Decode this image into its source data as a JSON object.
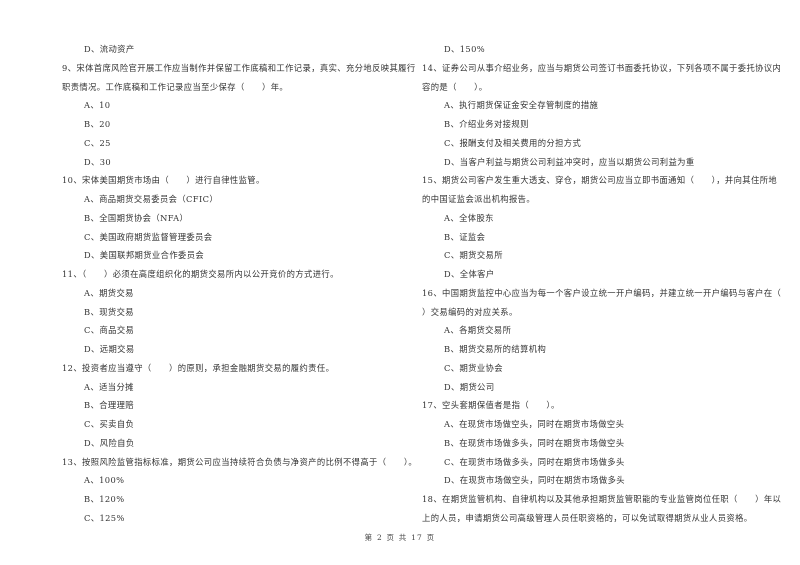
{
  "left_column": [
    {
      "type": "option",
      "text": "D、流动资产"
    },
    {
      "type": "question",
      "text": "9、宋体首席风险官开展工作应当制作并保留工作底稿和工作记录，真实、充分地反映其履行"
    },
    {
      "type": "question-cont",
      "text": "职责情况。工作底稿和工作记录应当至少保存（　　）年。"
    },
    {
      "type": "option",
      "text": "A、10"
    },
    {
      "type": "option",
      "text": "B、20"
    },
    {
      "type": "option",
      "text": "C、25"
    },
    {
      "type": "option",
      "text": "D、30"
    },
    {
      "type": "question",
      "text": "10、宋体美国期货市场由（　　）进行自律性监管。"
    },
    {
      "type": "option",
      "text": "A、商品期货交易委员会（CFIC）"
    },
    {
      "type": "option",
      "text": "B、全国期货协会（NFA）"
    },
    {
      "type": "option",
      "text": "C、美国政府期货监督管理委员会"
    },
    {
      "type": "option",
      "text": "D、美国联邦期货业合作委员会"
    },
    {
      "type": "question",
      "text": "11、（　　）必须在高度组织化的期货交易所内以公开竞价的方式进行。"
    },
    {
      "type": "option",
      "text": "A、期货交易"
    },
    {
      "type": "option",
      "text": "B、现货交易"
    },
    {
      "type": "option",
      "text": "C、商品交易"
    },
    {
      "type": "option",
      "text": "D、远期交易"
    },
    {
      "type": "question",
      "text": "12、投资者应当遵守（　　）的原则，承担金融期货交易的履约责任。"
    },
    {
      "type": "option",
      "text": "A、适当分摊"
    },
    {
      "type": "option",
      "text": "B、合理理赔"
    },
    {
      "type": "option",
      "text": "C、买卖自负"
    },
    {
      "type": "option",
      "text": "D、风险自负"
    },
    {
      "type": "question",
      "text": "13、按照风险监管指标标准，期货公司应当持续符合负债与净资产的比例不得高于（　　）。"
    },
    {
      "type": "option",
      "text": "A、100%"
    },
    {
      "type": "option",
      "text": "B、120%"
    },
    {
      "type": "option",
      "text": "C、125%"
    }
  ],
  "right_column": [
    {
      "type": "option",
      "text": "D、150%"
    },
    {
      "type": "question",
      "text": "14、证券公司从事介绍业务，应当与期货公司签订书面委托协议，下列各项不属于委托协议内"
    },
    {
      "type": "question-cont",
      "text": "容的是（　　）。"
    },
    {
      "type": "option",
      "text": "A、执行期货保证金安全存管制度的措施"
    },
    {
      "type": "option",
      "text": "B、介绍业务对接规则"
    },
    {
      "type": "option",
      "text": "C、报酬支付及相关费用的分担方式"
    },
    {
      "type": "option",
      "text": "D、当客户利益与期货公司利益冲突时，应当以期货公司利益为重"
    },
    {
      "type": "question",
      "text": "15、期货公司客户发生重大透支、穿仓，期货公司应当立即书面通知（　　），并向其住所地"
    },
    {
      "type": "question-cont",
      "text": "的中国证监会派出机构报告。"
    },
    {
      "type": "option",
      "text": "A、全体股东"
    },
    {
      "type": "option",
      "text": "B、证监会"
    },
    {
      "type": "option",
      "text": "C、期货交易所"
    },
    {
      "type": "option",
      "text": "D、全体客户"
    },
    {
      "type": "question",
      "text": "16、中国期货监控中心应当为每一个客户设立统一开户编码，并建立统一开户编码与客户在（"
    },
    {
      "type": "question-cont",
      "text": "）交易编码的对应关系。"
    },
    {
      "type": "option",
      "text": "A、各期货交易所"
    },
    {
      "type": "option",
      "text": "B、期货交易所的结算机构"
    },
    {
      "type": "option",
      "text": "C、期货业协会"
    },
    {
      "type": "option",
      "text": "D、期货公司"
    },
    {
      "type": "question",
      "text": "17、空头套期保值者是指（　　）。"
    },
    {
      "type": "option",
      "text": "A、在现货市场做空头，同时在期货市场做空头"
    },
    {
      "type": "option",
      "text": "B、在现货市场做多头，同时在期货市场做空头"
    },
    {
      "type": "option",
      "text": "C、在现货市场做多头，同时在期货市场做多头"
    },
    {
      "type": "option",
      "text": "D、在现货市场做空头，同时在期货市场做多头"
    },
    {
      "type": "question",
      "text": "18、在期货监管机构、自律机构以及其他承担期货监管职能的专业监管岗位任职（　　）年以"
    },
    {
      "type": "question-cont",
      "text": "上的人员，申请期货公司高级管理人员任职资格的，可以免试取得期货从业人员资格。"
    }
  ],
  "footer": {
    "page_label": "第 2 页 共 17 页"
  }
}
